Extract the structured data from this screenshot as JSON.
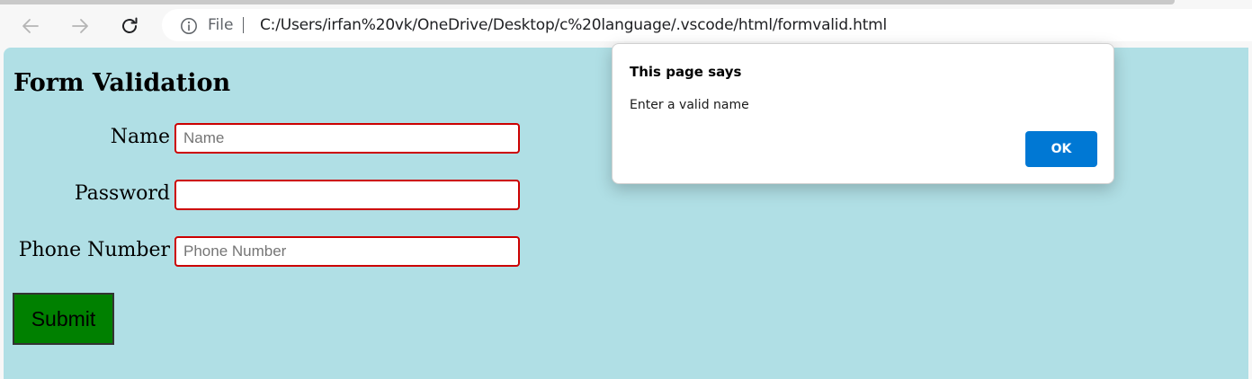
{
  "browser": {
    "address_bar": {
      "scheme_label": "File",
      "url": "C:/Users/irfan%20vk/OneDrive/Desktop/c%20language/.vscode/html/formvalid.html"
    },
    "icons": {
      "back": "back-arrow-icon",
      "forward": "forward-arrow-icon",
      "reload": "reload-icon",
      "info": "info-icon"
    }
  },
  "page": {
    "title": "Form Validation",
    "background_color": "#b0dfe5",
    "fields": [
      {
        "label": "Name",
        "placeholder": "Name",
        "value": ""
      },
      {
        "label": "Password",
        "placeholder": "",
        "value": ""
      },
      {
        "label": "Phone Number",
        "placeholder": "Phone Number",
        "value": ""
      }
    ],
    "field_border_color": "#cc0000",
    "submit_label": "Submit",
    "submit_color": "#008000"
  },
  "dialog": {
    "title": "This page says",
    "message": "Enter a valid name",
    "ok_label": "OK",
    "ok_color": "#0078d4"
  }
}
